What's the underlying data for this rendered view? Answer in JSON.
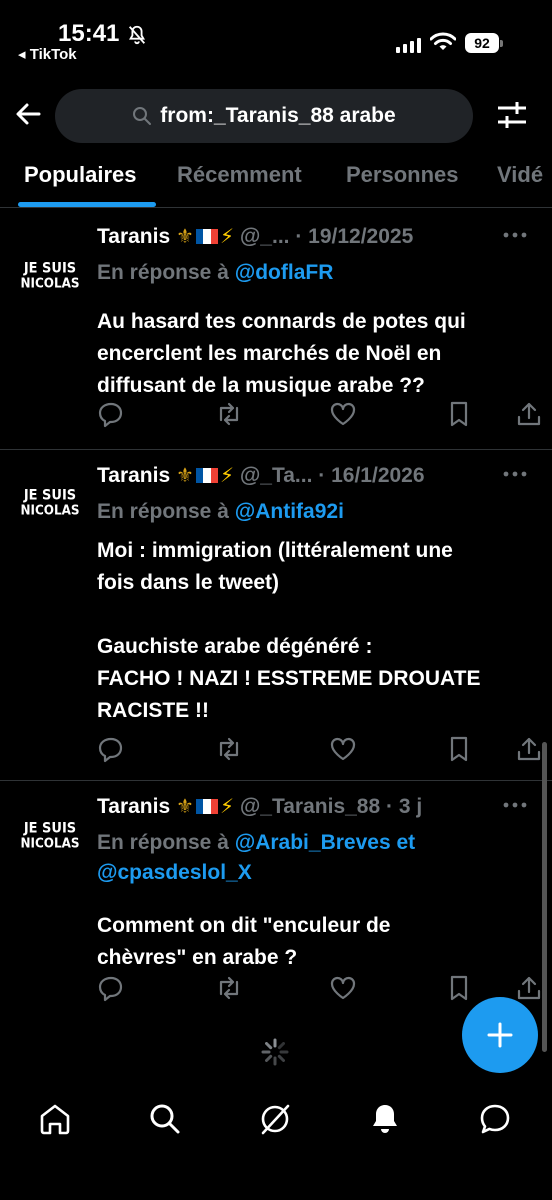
{
  "status": {
    "time": "15:41",
    "back_app": "◂ TikTok",
    "battery": "92"
  },
  "search": {
    "query": "from:_Taranis_88 arabe"
  },
  "tabs": [
    {
      "label": "Populaires",
      "active": true
    },
    {
      "label": "Récemment",
      "active": false
    },
    {
      "label": "Personnes",
      "active": false
    },
    {
      "label": "Vidé",
      "active": false
    }
  ],
  "tweets": [
    {
      "avatar_line1": "JE SUIS",
      "avatar_line2": "NICOLAS",
      "name": "Taranis",
      "emoji": "⚜️🇫🇷⚡",
      "handle": "@_...",
      "date": "· 19/12/2025",
      "reply_prefix": "En réponse à",
      "reply_to": "@doflaFR",
      "reply_to2": "",
      "text": "Au hasard tes connards de potes qui\nencerclent les marchés de Noël en\ndiffusant de la musique arabe ??"
    },
    {
      "avatar_line1": "JE SUIS",
      "avatar_line2": "NICOLAS",
      "name": "Taranis",
      "emoji": "⚜️🇫🇷⚡",
      "handle": "@_Ta...",
      "date": "· 16/1/2026",
      "reply_prefix": "En réponse à",
      "reply_to": "@Antifa92i",
      "reply_to2": "",
      "text": "Moi : immigration (littéralement une\nfois dans le tweet)\n\nGauchiste arabe dégénéré :\nFACHO ! NAZI ! ESSTREME DROUATE\nRACISTE !!"
    },
    {
      "avatar_line1": "JE SUIS",
      "avatar_line2": "NICOLAS",
      "name": "Taranis",
      "emoji": "⚜️🇫🇷⚡",
      "handle": "@_Taranis_88",
      "date": "· 3 j",
      "reply_prefix": "En réponse à",
      "reply_to": "@Arabi_Breves et",
      "reply_to2": "@cpasdeslol_X",
      "text": "Comment on dit \"enculeur de\nchèvres\" en arabe ?"
    }
  ],
  "colors": {
    "accent": "#1d9bf0",
    "muted": "#71767b",
    "background": "#000000"
  }
}
